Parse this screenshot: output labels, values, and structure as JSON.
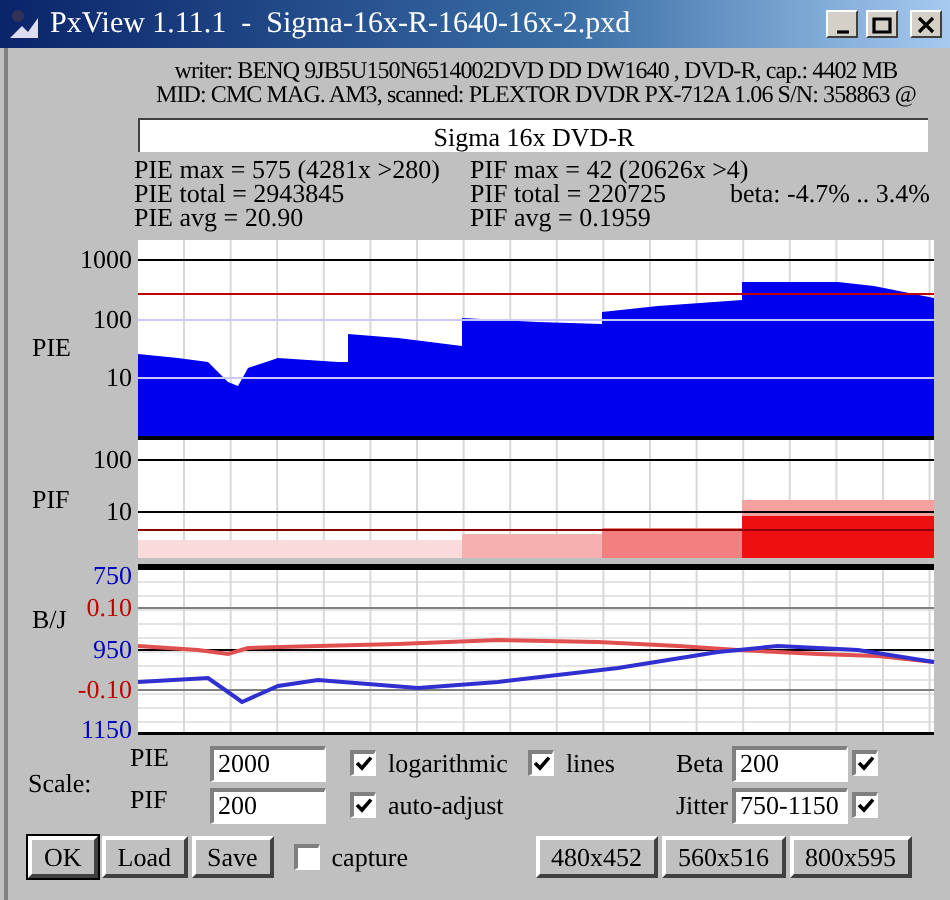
{
  "window": {
    "title": "PxView 1.11.1  -  Sigma-16x-R-1640-16x-2.pxd"
  },
  "info": [
    "writer: BENQ 9JB5U150N6514002DVD DD DW1640 , DVD-R, cap.: 4402 MB",
    "MID: CMC MAG. AM3, scanned: PLEXTOR DVDR PX-712A 1.06 S/N: 358863 @"
  ],
  "disc_label": "Sigma 16x DVD-R",
  "stats": {
    "pie": [
      "PIE max = 575 (4281x >280)",
      "PIE total = 2943845",
      "PIE avg = 20.90"
    ],
    "pif": [
      "PIF max = 42 (20626x >4)",
      "PIF total = 220725",
      "PIF avg = 0.1959"
    ],
    "beta": "beta: -4.7% .. 3.4%"
  },
  "charts": [
    {
      "kind": "pie",
      "label": "PIE",
      "ticks": [
        {
          "text": "1000",
          "color": "#000000"
        },
        {
          "text": "100",
          "color": "#000000"
        },
        {
          "text": "10",
          "color": "#000000"
        }
      ]
    },
    {
      "kind": "pif",
      "label": "PIF",
      "ticks": [
        {
          "text": "100",
          "color": "#000000"
        },
        {
          "text": "10",
          "color": "#000000"
        }
      ]
    },
    {
      "kind": "bj",
      "label": "B/J",
      "ticks": [
        {
          "text": "750",
          "color": "#0000c0"
        },
        {
          "text": "0.10",
          "color": "#c00000"
        },
        {
          "text": "950",
          "color": "#0000c0"
        },
        {
          "text": "-0.10",
          "color": "#c00000"
        },
        {
          "text": "1150",
          "color": "#0000c0"
        }
      ]
    }
  ],
  "scale": {
    "label": "Scale:",
    "fields": [
      {
        "label": "PIE",
        "value": "2000"
      },
      {
        "label": "PIF",
        "value": "200"
      }
    ],
    "options": [
      {
        "label": "logarithmic",
        "checked": true
      },
      {
        "label": "lines",
        "checked": true
      },
      {
        "label": "auto-adjust",
        "checked": true
      }
    ],
    "right_fields": [
      {
        "label": "Beta",
        "value": "200",
        "checked": true
      },
      {
        "label": "Jitter",
        "value": "750-1150",
        "checked": true
      }
    ]
  },
  "buttons": [
    {
      "label": "OK",
      "default": true
    },
    {
      "label": "Load",
      "default": false
    },
    {
      "label": "Save",
      "default": false
    }
  ],
  "capture": {
    "label": "capture",
    "checked": false
  },
  "size_buttons": [
    "480x452",
    "560x516",
    "800x595"
  ]
}
